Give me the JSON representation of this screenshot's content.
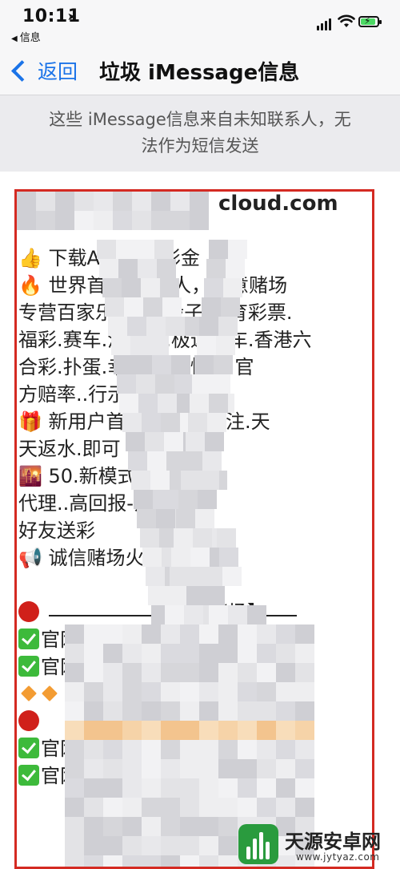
{
  "status_bar": {
    "time": "10:11",
    "back_to_app": "信息",
    "icons": [
      "location-arrow-icon",
      "signal-icon",
      "wifi-icon",
      "battery-charging-icon"
    ]
  },
  "nav": {
    "back_label": "返回",
    "title": "垃圾 iMessage信息"
  },
  "notice": {
    "text": "这些 iMessage信息来自未知联系人，无法作为短信发送"
  },
  "message": {
    "sender_fragment": "cloud.com",
    "lines": [
      "👍 下载APP即送彩金",
      "🔥 世界首先AG真人，如意赌场",
      "专营百家乐.棋牌.骰子.体育彩票.",
      "福彩.赛车.港跑马.极速赛车.香港六",
      "合彩.扑蛋.幸运飞艇.快三.官",
      "方赔率..行示",
      "🎁 新用户首存888元.投注.天",
      "天返水.即可",
      "🌇 50.新模式.人人做",
      "代理..高回报-介绍",
      "好友送彩",
      "📢 诚信赌场火速到帐！",
      "赌场】",
      "官网",
      "官网",
      "",
      "",
      "官网",
      "官网"
    ]
  },
  "watermark": {
    "title": "天源安卓网",
    "url": "www.jytyaz.com"
  },
  "colors": {
    "accent_blue": "#1a73e8",
    "highlight_red": "#d42a22",
    "check_green": "#3dba3b",
    "bar_bg": "#f7f7f8",
    "notice_bg": "#ebebee"
  }
}
